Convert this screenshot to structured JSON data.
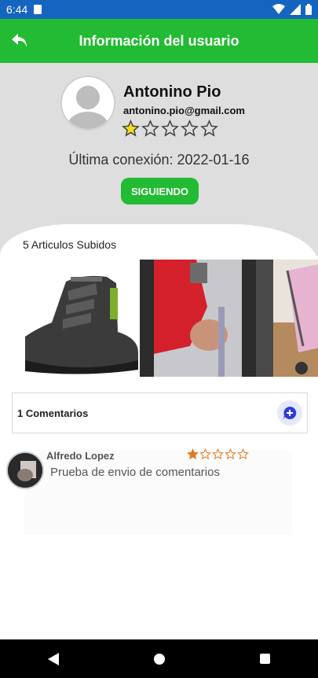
{
  "status_bar": {
    "time": "6:44",
    "icons": [
      "sd-card-icon",
      "wifi-icon",
      "signal-icon",
      "battery-icon"
    ]
  },
  "app_bar": {
    "title": "Información del usuario",
    "back_icon": "back-arrow-icon",
    "color": "#22bb33"
  },
  "profile": {
    "name": "Antonino Pio",
    "email": "antonino.pio@gmail.com",
    "rating": 1,
    "rating_max": 5,
    "last_connection": "Última conexión: 2022-01-16",
    "follow_label": "SIGUIENDO"
  },
  "articles": {
    "title": "5 Articulos Subidos",
    "photos": [
      "hiking-boot-photo",
      "person-photo",
      "stroller-photo"
    ]
  },
  "comments": {
    "count_label": "1 Comentarios",
    "add_icon": "add-comment-icon",
    "items": [
      {
        "author": "Alfredo Lopez",
        "rating": 1,
        "rating_max": 5,
        "text": "Prueba de envio de comentarios"
      }
    ]
  },
  "nav_bar": {
    "buttons": [
      "back-triangle-icon",
      "home-circle-icon",
      "recents-square-icon"
    ]
  }
}
